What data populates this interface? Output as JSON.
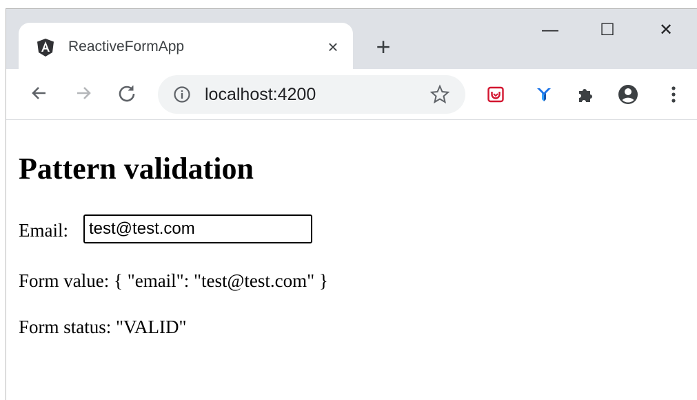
{
  "browser": {
    "tab_title": "ReactiveFormApp",
    "tab_close": "×",
    "new_tab": "+",
    "url": "localhost:4200",
    "window_controls": {
      "minimize": "—",
      "maximize": "☐",
      "close": "✕"
    },
    "icons": [
      "angular-icon",
      "back-icon",
      "forward-icon",
      "reload-icon",
      "info-icon",
      "star-icon",
      "pocket-icon",
      "y-extension-icon",
      "puzzle-icon",
      "profile-icon",
      "menu-icon"
    ]
  },
  "page": {
    "heading": "Pattern validation",
    "email_label": "Email:",
    "email_value": "test@test.com",
    "form_value_text": "Form value: { \"email\": \"test@test.com\" }",
    "form_status_text": "Form status: \"VALID\""
  },
  "colors": {
    "tabstrip": "#dee1e6",
    "omnibox": "#f1f3f4",
    "pocket_red": "#d3152f",
    "y_blue": "#1a73e8"
  }
}
